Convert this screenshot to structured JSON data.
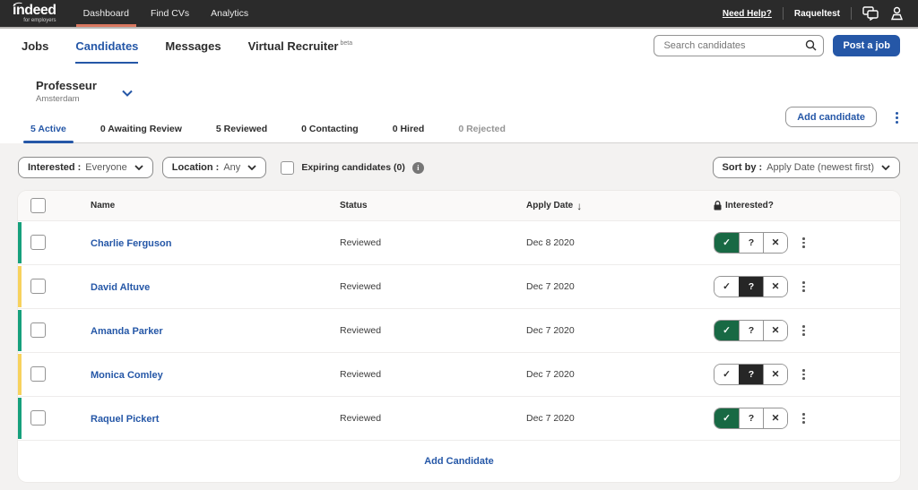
{
  "topbar": {
    "logo": "indeed",
    "logo_sub": "for employers",
    "nav": [
      {
        "label": "Dashboard",
        "active": true
      },
      {
        "label": "Find CVs",
        "active": false
      },
      {
        "label": "Analytics",
        "active": false
      }
    ],
    "need_help": "Need Help?",
    "username": "Raqueltest"
  },
  "subnav": {
    "tabs": [
      {
        "label": "Jobs"
      },
      {
        "label": "Candidates",
        "active": true
      },
      {
        "label": "Messages"
      },
      {
        "label": "Virtual Recruiter",
        "badge": "beta"
      }
    ],
    "search_placeholder": "Search candidates",
    "post_job_label": "Post a job"
  },
  "job": {
    "title": "Professeur",
    "location": "Amsterdam",
    "add_candidate_label": "Add candidate",
    "status_tabs": [
      {
        "label": "5 Active",
        "active": true
      },
      {
        "label": "0 Awaiting Review"
      },
      {
        "label": "5 Reviewed"
      },
      {
        "label": "0 Contacting"
      },
      {
        "label": "0 Hired"
      },
      {
        "label": "0 Rejected",
        "disabled": true
      }
    ]
  },
  "filters": {
    "interested_label": "Interested :",
    "interested_value": "Everyone",
    "location_label": "Location :",
    "location_value": "Any",
    "expiring_label": "Expiring candidates (0)",
    "sort_label": "Sort by :",
    "sort_value": "Apply Date (newest first)"
  },
  "table": {
    "headers": {
      "name": "Name",
      "status": "Status",
      "apply_date": "Apply Date",
      "interested": "Interested?"
    },
    "rows": [
      {
        "name": "Charlie Ferguson",
        "status": "Reviewed",
        "apply_date": "Dec 8 2020",
        "interest": "yes",
        "bar": "green"
      },
      {
        "name": "David Altuve",
        "status": "Reviewed",
        "apply_date": "Dec 7 2020",
        "interest": "maybe",
        "bar": "yellow"
      },
      {
        "name": "Amanda Parker",
        "status": "Reviewed",
        "apply_date": "Dec 7 2020",
        "interest": "yes",
        "bar": "green"
      },
      {
        "name": "Monica Comley",
        "status": "Reviewed",
        "apply_date": "Dec 7 2020",
        "interest": "maybe",
        "bar": "yellow"
      },
      {
        "name": "Raquel Pickert",
        "status": "Reviewed",
        "apply_date": "Dec 7 2020",
        "interest": "yes",
        "bar": "green"
      }
    ],
    "footer_add_label": "Add Candidate"
  },
  "icons": {
    "check": "✓",
    "question": "?",
    "cross": "✕",
    "sort_arrow_down": "↓",
    "info": "i"
  },
  "colors": {
    "brand_blue": "#2557a7",
    "topbar_bg": "#2b2b2b",
    "active_nav_underline": "#d9775f",
    "interested_yes_green": "#186944",
    "interested_maybe_dark": "#262626",
    "bars": {
      "green": "#16a07c",
      "yellow": "#f7d25e"
    },
    "page_bg": "#f3f2f1"
  }
}
